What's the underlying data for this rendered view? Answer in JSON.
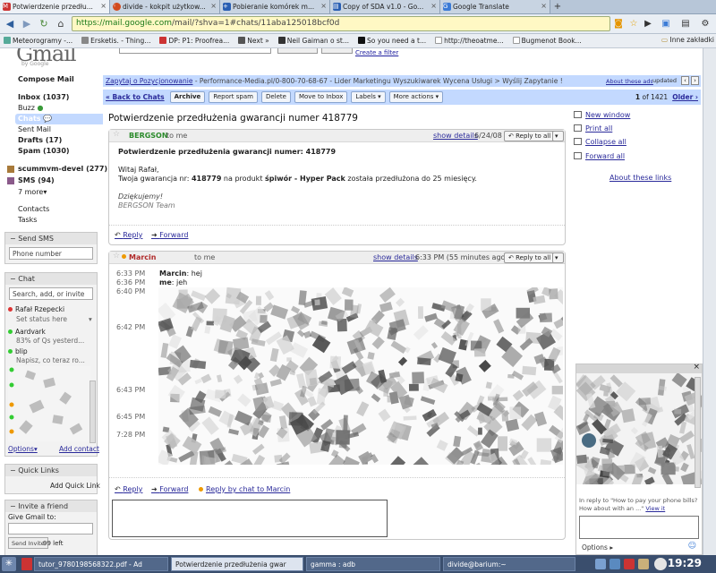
{
  "browser": {
    "tabs": [
      {
        "label": "Potwierdzenie przedłu...",
        "icon": "gmail-icon",
        "color": "#c33"
      },
      {
        "label": "divide - kokpit użytkow...",
        "icon": "circle-icon",
        "color": "#d24b1f"
      },
      {
        "label": "Pobieranie komórek m...",
        "icon": "plus-icon",
        "color": "#2a5fb3"
      },
      {
        "label": "Copy of SDA v1.0 - Go...",
        "icon": "spreadsheet-icon",
        "color": "#2a5fb3"
      },
      {
        "label": "Google Translate",
        "icon": "translate-icon",
        "color": "#3b7bd6"
      }
    ],
    "url": {
      "prefix": "https://mail.google.com",
      "path": "/mail/?shva=1#chats/11aba125018bcf0d"
    },
    "bookmarks": [
      {
        "label": "Meteorogramy -...",
        "color": "#5a9"
      },
      {
        "label": "Ersketis. - Thing...",
        "color": "#888"
      },
      {
        "label": "DP: P1: Proofrea...",
        "color": "#c33"
      },
      {
        "label": "Next »",
        "color": "#555"
      },
      {
        "label": "Neil Gaiman o st...",
        "color": "#333"
      },
      {
        "label": "So you need a t...",
        "color": "#111"
      },
      {
        "label": "http://theoatme...",
        "color": "#999"
      },
      {
        "label": "Bugmenot Book...",
        "color": "#999"
      }
    ],
    "bookmarks_other": "Inne zakładki"
  },
  "gmail": {
    "logo": "Gmail",
    "logo_sub": "by Google",
    "filter_link": "Create a filter",
    "nav": {
      "compose": "Compose Mail",
      "inbox": "Inbox (1037)",
      "buzz": "Buzz",
      "chats": "Chats",
      "sent": "Sent Mail",
      "drafts": "Drafts (17)",
      "spam": "Spam (1030)",
      "label1": "scummvm-devel (277)",
      "label2": "SMS (94)",
      "more": "7 more▾",
      "contacts": "Contacts",
      "tasks": "Tasks"
    },
    "sms": {
      "title": "Send SMS",
      "placeholder": "Phone number"
    },
    "chat": {
      "title": "Chat",
      "search_placeholder": "Search, add, or invite",
      "me": "Rafał Rzepecki",
      "status": "Set status here",
      "contacts": [
        {
          "name": "Aardvark",
          "sub": "83% of Qs yesterd...",
          "color": "#3c3"
        },
        {
          "name": "blip",
          "sub": "Napisz, co teraz ro...",
          "color": "#3c3"
        }
      ],
      "options": "Options",
      "add_contact": "Add contact"
    },
    "quick_links": {
      "title": "Quick Links",
      "add": "Add Quick Link"
    },
    "invite": {
      "title": "Invite a friend",
      "label": "Give Gmail to:",
      "button": "Send Invite",
      "left": "99 left"
    },
    "ad_bar": {
      "ad_link": "Zapytaj o Pozycjonowanie",
      "ad_text": " - Performance-Media.pl/0-800-70-68-67 - Lider Marketingu Wyszukiwarek Wycena Usługi > Wyślij Zapytanie !",
      "about": "About these ads",
      "updated": "updated"
    },
    "actions": {
      "back": "« Back to Chats",
      "archive": "Archive",
      "report_spam": "Report spam",
      "delete": "Delete",
      "move": "Move to Inbox",
      "labels": "Labels ▾",
      "more": "More actions ▾",
      "count_prefix": "1",
      "count": " of 1421",
      "older": "Older ›"
    },
    "subject": "Potwierdzenie przedłużenia gwarancji numer 418779",
    "message1": {
      "from": "BERGSON",
      "to": "to me",
      "show_details": "show details",
      "date": "6/24/08",
      "reply": "Reply to all",
      "title": "Potwierdzenie przedłużenia gwarancji numer: 418779",
      "greeting": "Witaj Rafał,",
      "body_prefix": "Twoja gwarancja nr: ",
      "number": "418779",
      "body_mid": " na produkt ",
      "product": "śpiwór - Hyper Pack",
      "body_suffix": " została przedłużona do 25 miesięcy.",
      "thanks": "Dziękujemy!",
      "team": "BERGSON Team",
      "foot_reply": "Reply",
      "foot_forward": "Forward"
    },
    "message2": {
      "from": "Marcin",
      "to": "to me",
      "show_details": "show details",
      "date": "6:33 PM (55 minutes ago)",
      "reply": "Reply to all",
      "lines": [
        {
          "time": "6:33 PM",
          "who": "Marcin",
          "text": ": hej"
        },
        {
          "time": "6:36 PM",
          "who": "me",
          "text": ": jeh"
        },
        {
          "time": "6:40 PM",
          "who": "",
          "text": ""
        },
        {
          "time": "6:42 PM",
          "who": "",
          "text": ""
        },
        {
          "time": "6:43 PM",
          "who": "",
          "text": ""
        },
        {
          "time": "6:45 PM",
          "who": "",
          "text": ""
        },
        {
          "time": "7:28 PM",
          "who": "",
          "text": ""
        }
      ],
      "foot_reply": "Reply",
      "foot_forward": "Forward",
      "foot_chat": "Reply by chat to Marcin"
    },
    "right": {
      "new_window": "New window",
      "print_all": "Print all",
      "collapse_all": "Collapse all",
      "forward_all": "Forward all",
      "about": "About these links"
    },
    "mini_chat": {
      "text": "In reply to \"How to pay your phone bills? How about with an ...\"",
      "view": "View it",
      "options": "Options ▸"
    }
  },
  "taskbar": {
    "items": [
      {
        "label": "tutor_9780198568322.pdf - Ad"
      },
      {
        "label": "Potwierdzenie przedłużenia gwar"
      },
      {
        "label": "gamma : adb"
      },
      {
        "label": "divide@barium:~"
      }
    ],
    "clock": "19:29"
  }
}
